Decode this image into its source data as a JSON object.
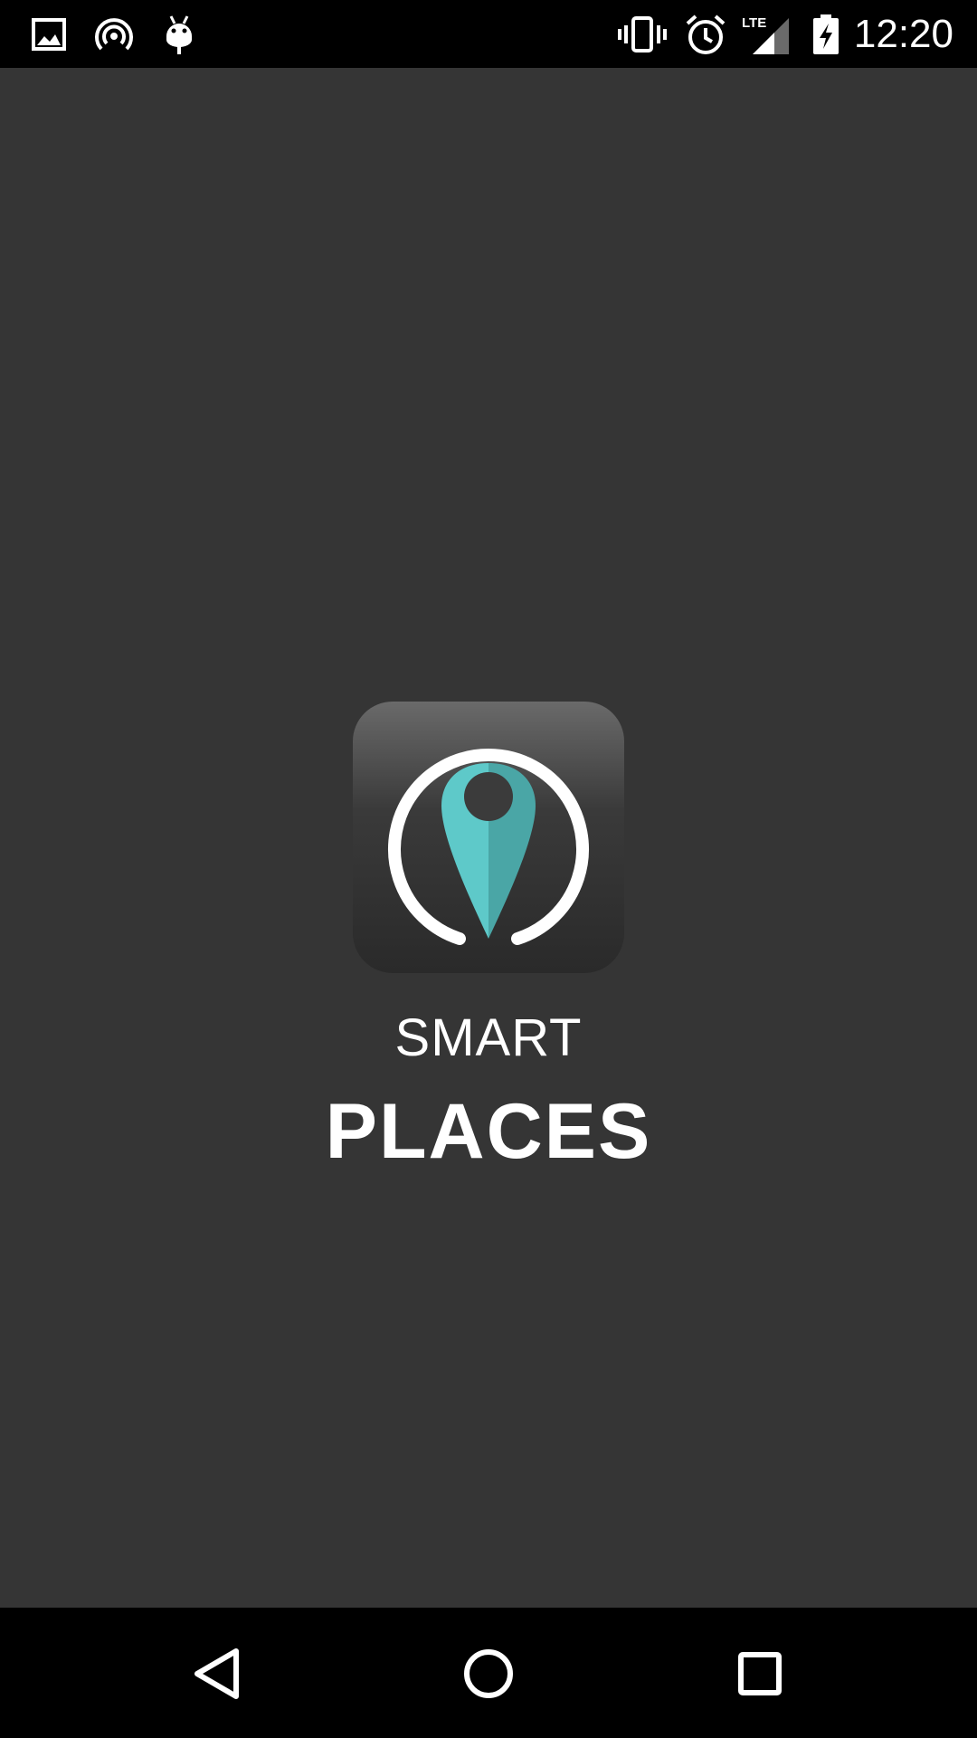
{
  "status_bar": {
    "left_icons": [
      "image-notification-icon",
      "hotspot-icon",
      "android-debug-icon"
    ],
    "right_icons": [
      "vibrate-icon",
      "alarm-icon",
      "lte-signal-icon",
      "battery-charging-icon"
    ],
    "network_label": "LTE",
    "time": "12:20"
  },
  "splash": {
    "logo_icon": "location-pin-icon",
    "title_line1": "SMART",
    "title_line2": "PLACES",
    "colors": {
      "background": "#353535",
      "pin_light": "#5ec9c9",
      "pin_dark": "#4aa6a6",
      "ring": "#ffffff"
    }
  },
  "nav_bar": {
    "buttons": [
      "back-icon",
      "home-icon",
      "recents-icon"
    ]
  }
}
